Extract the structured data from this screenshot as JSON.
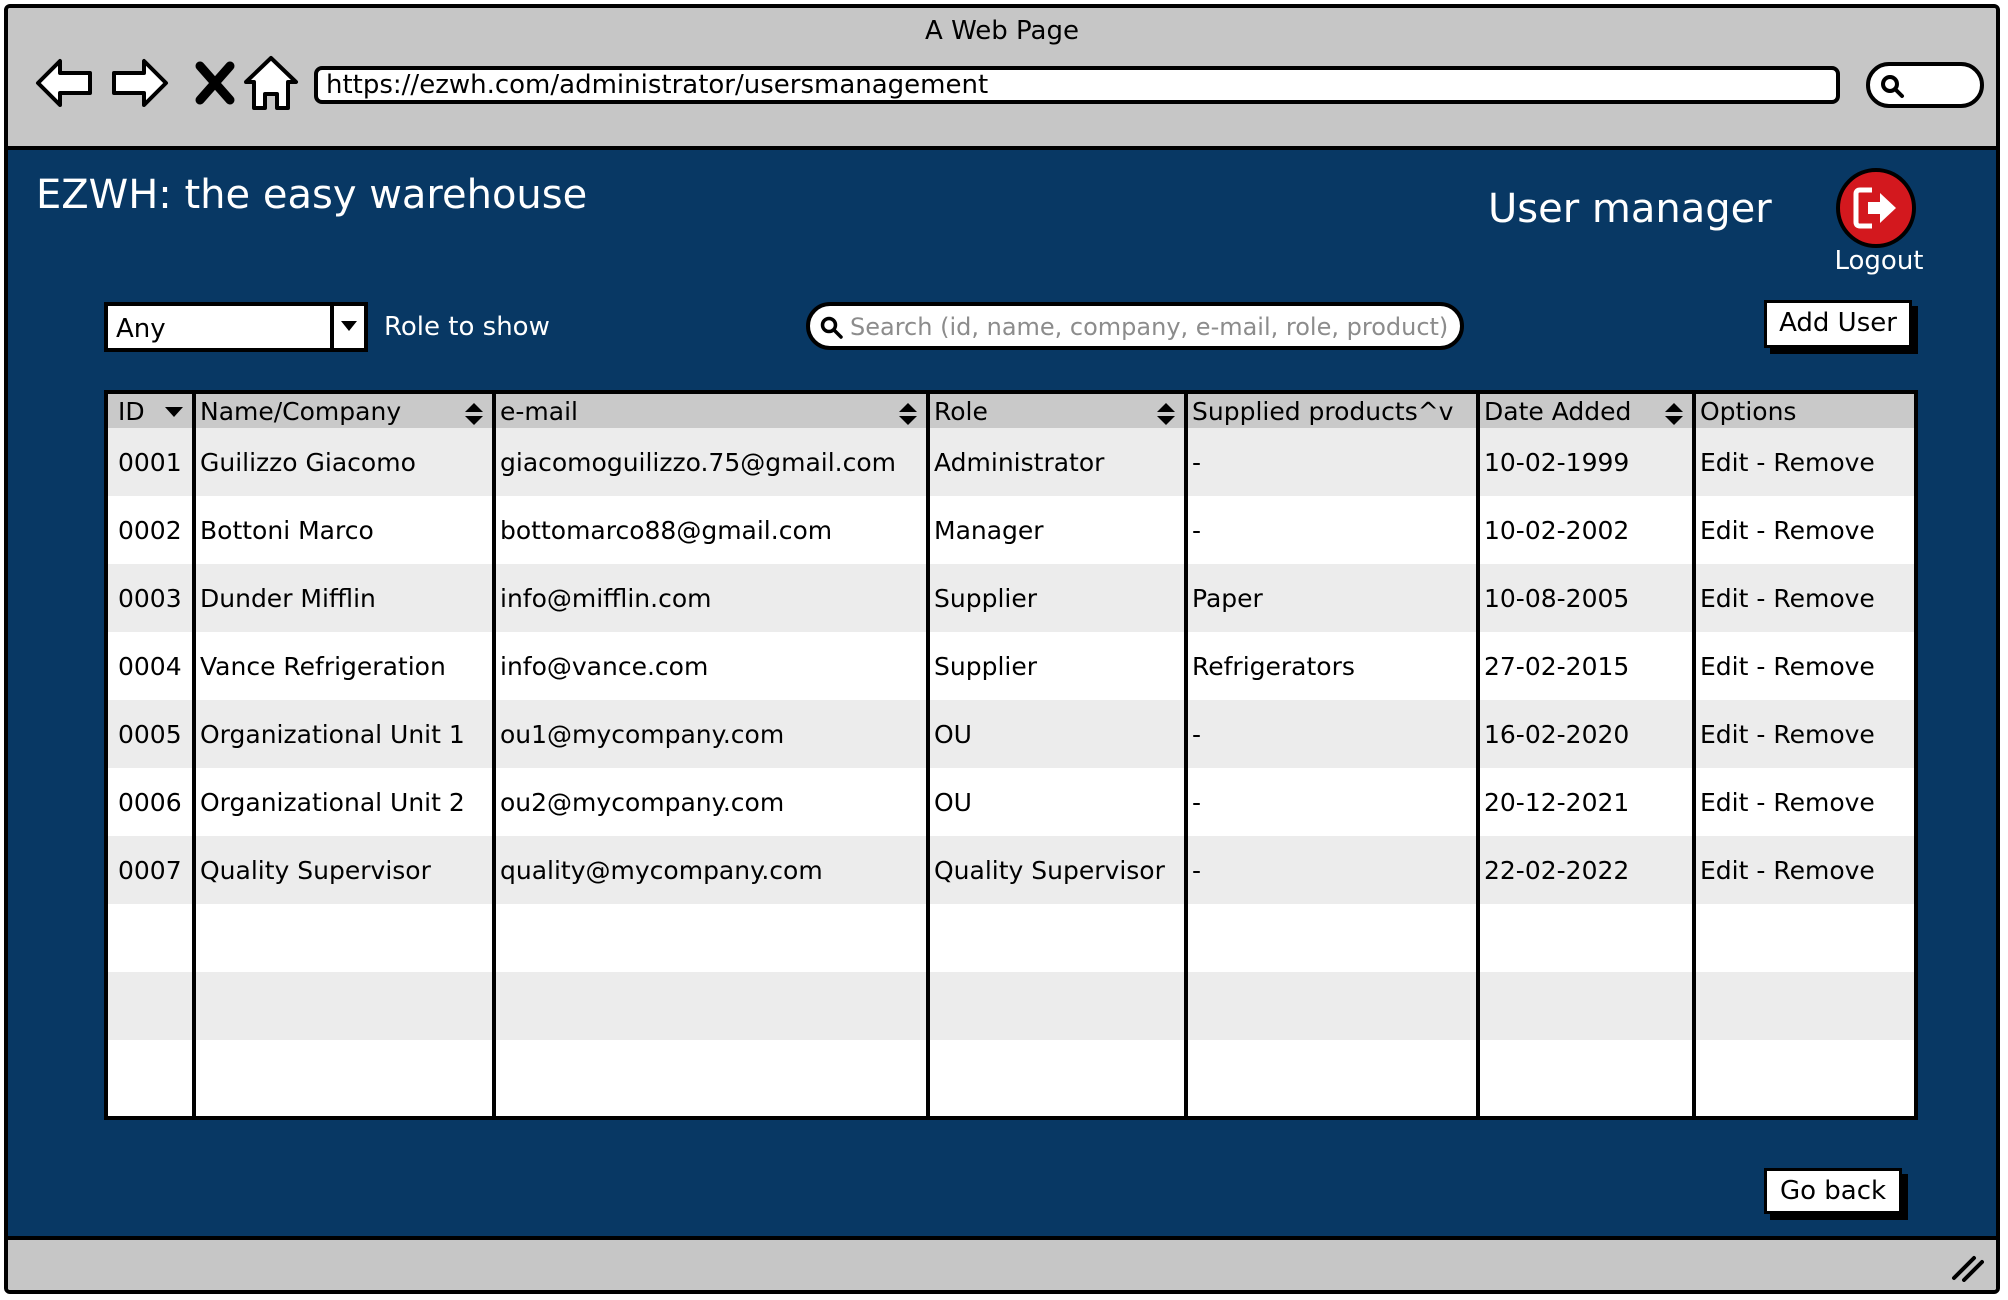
{
  "browser": {
    "title": "A Web Page",
    "url": "https://ezwh.com/administrator/usersmanagement"
  },
  "header": {
    "brand": "EZWH: the easy warehouse",
    "page_title": "User manager",
    "logout_label": "Logout",
    "logout_color": "#d3181e"
  },
  "colors": {
    "page_background": "#083864",
    "chrome_background": "#c6c6c6",
    "row_alt": "#ececec",
    "header_row": "#c9c9c9"
  },
  "filters": {
    "role_value": "Any",
    "role_label": "Role to show",
    "search_placeholder": "Search (id, name, company, e-mail, role, product)",
    "search_value": ""
  },
  "buttons": {
    "add_user": "Add User",
    "go_back": "Go back"
  },
  "icons": {
    "back": "back-arrow-icon",
    "forward": "forward-arrow-icon",
    "stop": "close-icon",
    "home": "home-icon",
    "search": "search-icon",
    "logout": "logout-icon",
    "dropdown": "chevron-down-icon",
    "sort": "sort-icon",
    "resize": "resize-grip-icon"
  },
  "table": {
    "headers": [
      "ID",
      "Name/Company",
      "e-mail",
      "Role",
      "Supplied products^v",
      "Date Added",
      "Options"
    ],
    "rows": [
      {
        "id": "0001",
        "name": "Guilizzo Giacomo",
        "email": "giacomoguilizzo.75@gmail.com",
        "role": "Administrator",
        "products": "-",
        "date": "10-02-1999",
        "edit": "Edit",
        "sep": " - ",
        "remove": "Remove"
      },
      {
        "id": "0002",
        "name": "Bottoni Marco",
        "email": "bottomarco88@gmail.com",
        "role": "Manager",
        "products": "-",
        "date": "10-02-2002",
        "edit": "Edit",
        "sep": " - ",
        "remove": "Remove"
      },
      {
        "id": "0003",
        "name": "Dunder Mifflin",
        "email": "info@mifflin.com",
        "role": "Supplier",
        "products": "Paper",
        "date": "10-08-2005",
        "edit": "Edit",
        "sep": " - ",
        "remove": "Remove"
      },
      {
        "id": "0004",
        "name": "Vance Refrigeration",
        "email": "info@vance.com",
        "role": "Supplier",
        "products": "Refrigerators",
        "date": "27-02-2015",
        "edit": "Edit",
        "sep": " - ",
        "remove": "Remove"
      },
      {
        "id": "0005",
        "name": "Organizational Unit 1",
        "email": "ou1@mycompany.com",
        "role": "OU",
        "products": "-",
        "date": "16-02-2020",
        "edit": "Edit",
        "sep": " - ",
        "remove": "Remove"
      },
      {
        "id": "0006",
        "name": "Organizational Unit 2",
        "email": "ou2@mycompany.com",
        "role": "OU",
        "products": "-",
        "date": "20-12-2021",
        "edit": "Edit",
        "sep": " - ",
        "remove": "Remove"
      },
      {
        "id": "0007",
        "name": "Quality Supervisor",
        "email": "quality@mycompany.com",
        "role": "Quality Supervisor",
        "products": "-",
        "date": "22-02-2022",
        "edit": "Edit",
        "sep": " - ",
        "remove": "Remove"
      }
    ],
    "empty_rows": 3
  }
}
